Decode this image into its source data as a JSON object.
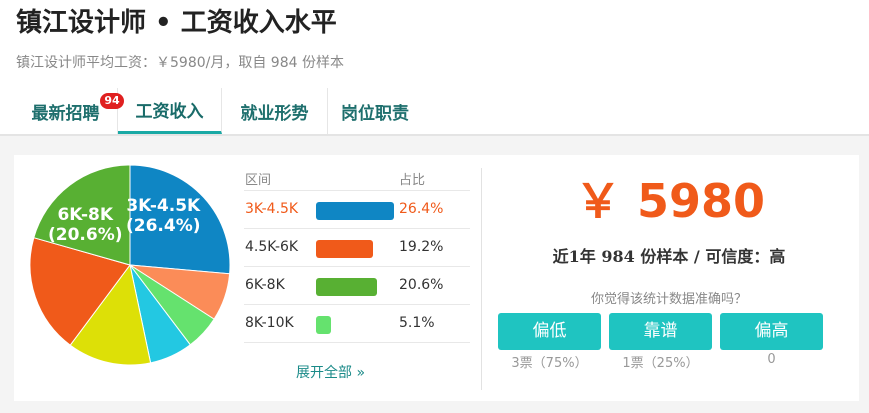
{
  "header": {
    "title": "镇江设计师 • 工资收入水平",
    "subtitle": "镇江设计师平均工资：￥5980/月，取自 984 份样本"
  },
  "tabs": [
    {
      "label": "最新招聘",
      "badge": "94"
    },
    {
      "label": "工资收入"
    },
    {
      "label": "就业形势"
    },
    {
      "label": "岗位职责"
    }
  ],
  "colors": {
    "accent": "#1fc4c1",
    "orange": "#f05a1a",
    "tab_text": "#1e6f6d"
  },
  "chart_data": {
    "type": "pie",
    "slices": [
      {
        "label": "3K-4.5K",
        "value": 26.4,
        "color": "#0f86c4"
      },
      {
        "label": "4.5K-6K",
        "value": 19.2,
        "color": "#f05a1a"
      },
      {
        "label": "",
        "value": 13.5,
        "color": "#dde007"
      },
      {
        "label": "",
        "value": 7.0,
        "color": "#23c8e2"
      },
      {
        "label": "",
        "value": 5.6,
        "color": "#65e26e"
      },
      {
        "label": "",
        "value": 7.7,
        "color": "#fb8c58"
      },
      {
        "label": "6K-8K",
        "value": 20.6,
        "color": "#58b033"
      }
    ],
    "slice_order_clockwise_from_top": [
      "3K-4.5K",
      "orange-small",
      "green-light",
      "cyan",
      "yellow",
      "4.5K-6K",
      "6K-8K"
    ],
    "pie_labels": [
      {
        "range": "3K-4.5K",
        "pct": "(26.4%)"
      },
      {
        "range": "6K-8K",
        "pct": "(20.6%)"
      }
    ]
  },
  "table": {
    "headers": {
      "range": "区间",
      "ratio": "占比"
    },
    "rows": [
      {
        "range": "3K-4.5K",
        "pct": "26.4%",
        "value": 26.4,
        "color": "#0f86c4",
        "highlight": true
      },
      {
        "range": "4.5K-6K",
        "pct": "19.2%",
        "value": 19.2,
        "color": "#f05a1a",
        "highlight": false
      },
      {
        "range": "6K-8K",
        "pct": "20.6%",
        "value": 20.6,
        "color": "#58b033",
        "highlight": false
      },
      {
        "range": "8K-10K",
        "pct": "5.1%",
        "value": 5.1,
        "color": "#65e26e",
        "highlight": false
      }
    ],
    "expand_label": "展开全部 »"
  },
  "summary": {
    "salary": "￥ 5980",
    "trust_text": "近1年 984 份样本 / 可信度：高",
    "question": "你觉得该统计数据准确吗？"
  },
  "votes": [
    {
      "label": "偏低",
      "count": "3票（75%）"
    },
    {
      "label": "靠谱",
      "count": "1票（25%）"
    },
    {
      "label": "偏高",
      "count": "0"
    }
  ]
}
